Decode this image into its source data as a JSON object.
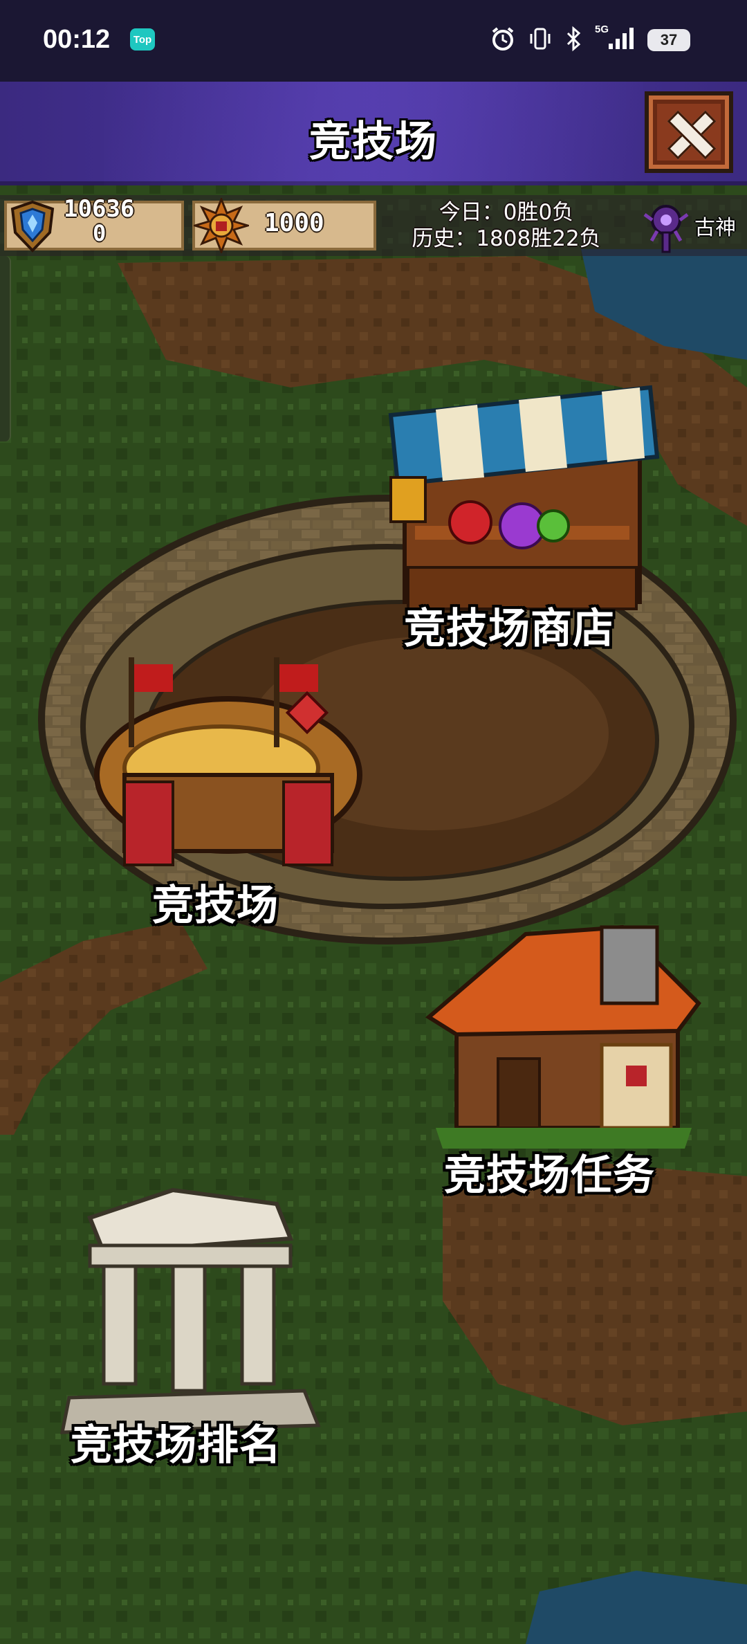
{
  "status_bar": {
    "time": "00:12",
    "app_badge": "Top",
    "network": "5G",
    "battery": "37"
  },
  "header": {
    "title": "竞技场",
    "close_icon": "close-x-icon"
  },
  "resources": {
    "shield_value": "10636",
    "shield_sub": "0",
    "sun_value": "1000",
    "today_record": "今日：0胜0负",
    "history_record": "历史：1808胜22负",
    "god_label": "古神"
  },
  "locations": {
    "shop": "竞技场商店",
    "arena": "竞技场",
    "quest": "竞技场任务",
    "ranking": "竞技场排名"
  },
  "colors": {
    "title_bar": "#4a35a0",
    "status_bar": "#1b1733",
    "grass": "#2d4a1c",
    "dirt": "#5a3a1e",
    "water": "#1f4a66"
  }
}
